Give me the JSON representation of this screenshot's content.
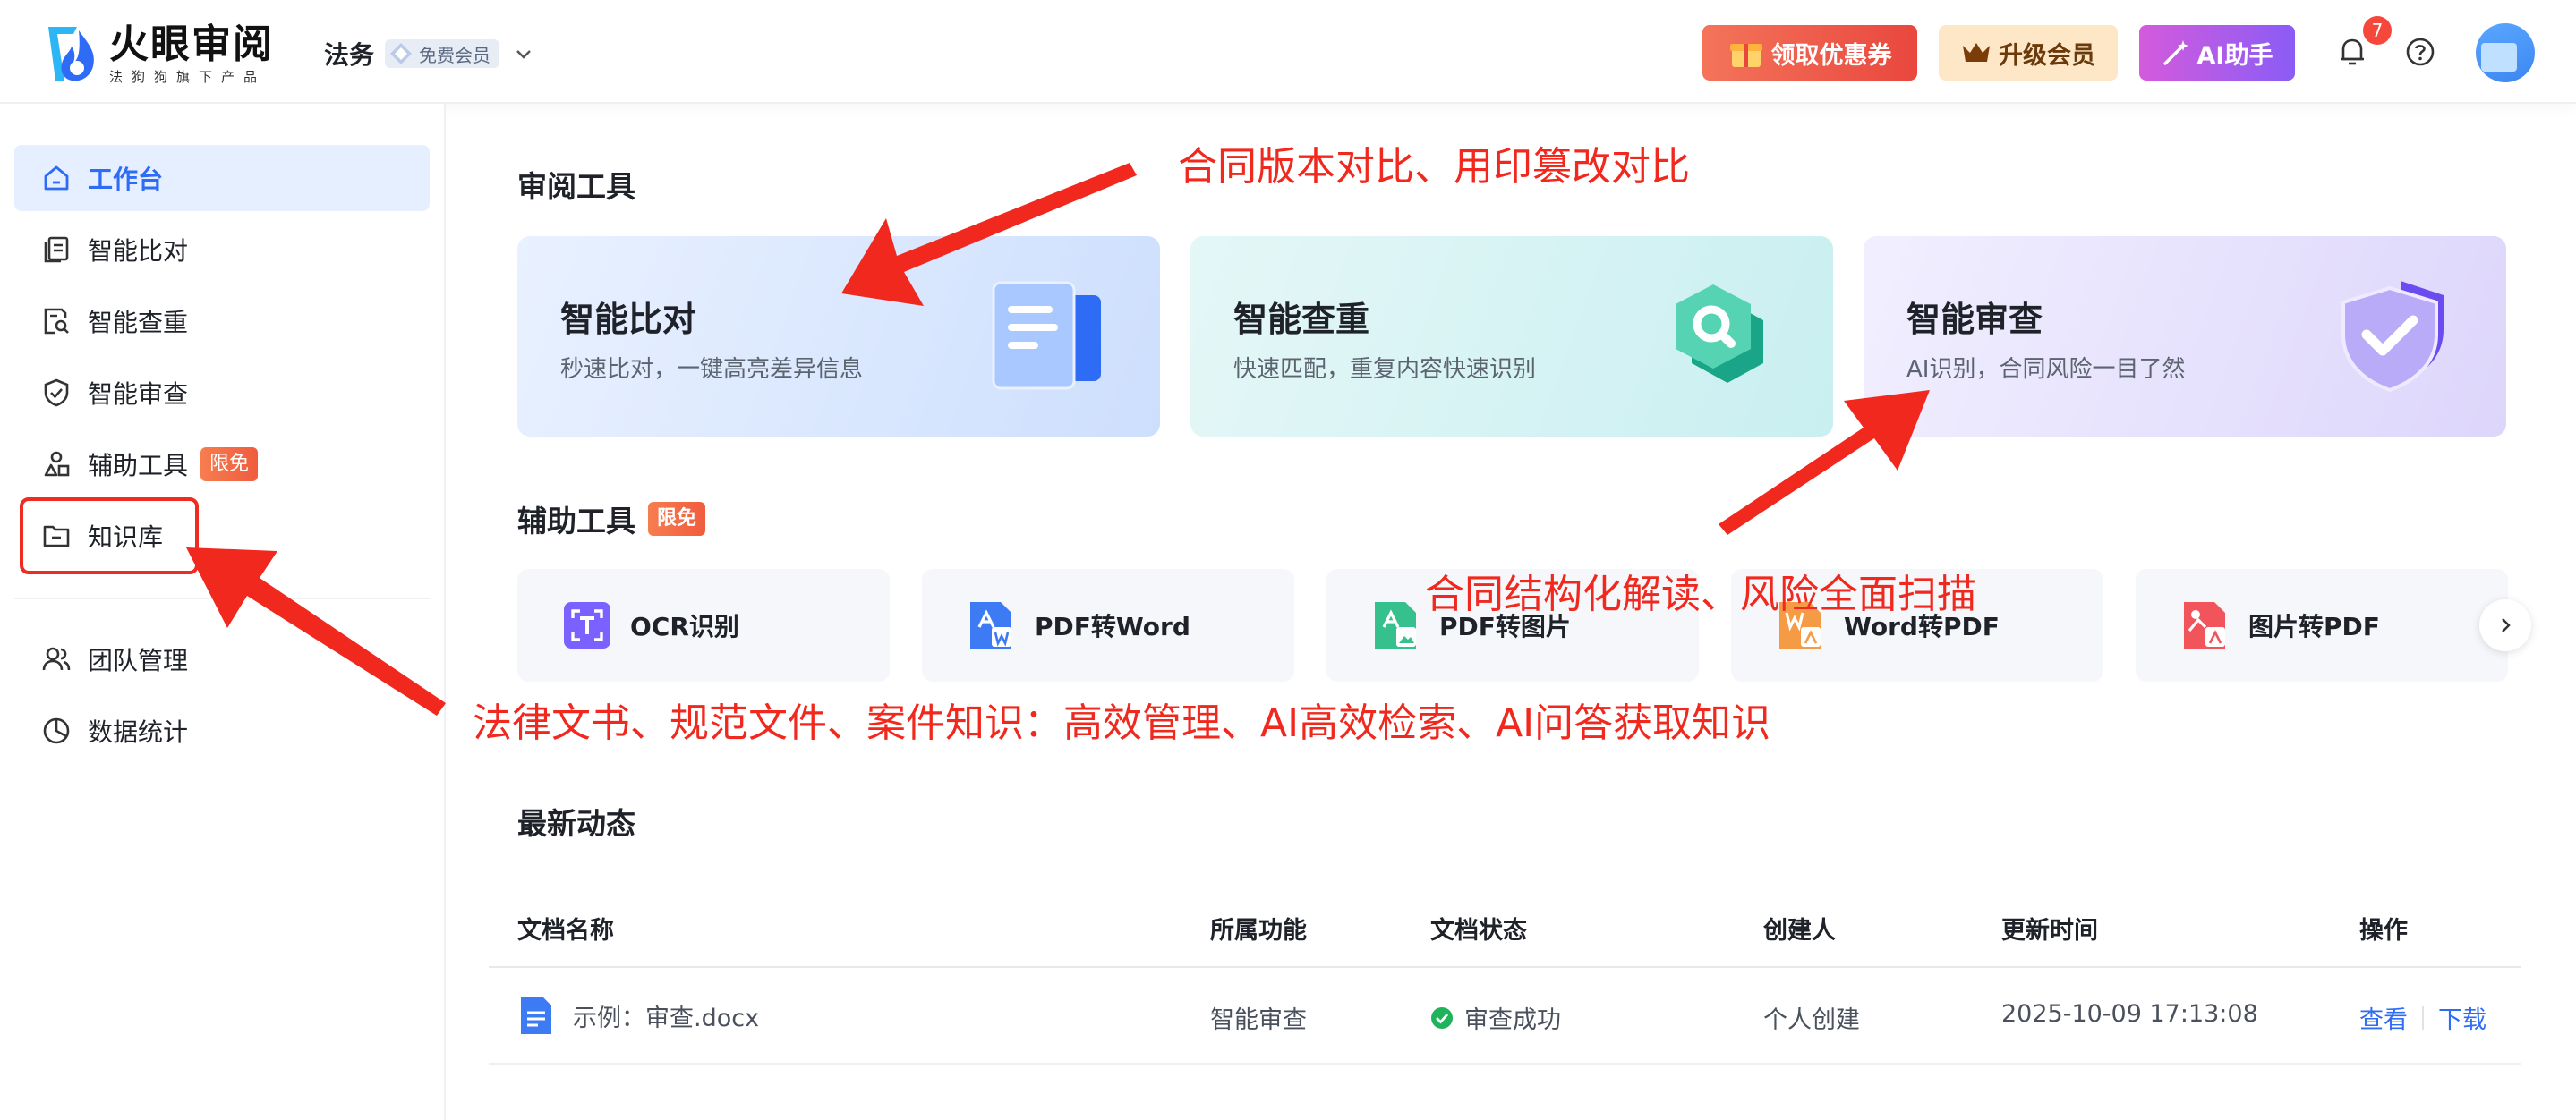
{
  "header": {
    "logo_title": "火眼审阅",
    "logo_sub": "法狗狗旗下产品",
    "org_name": "法务",
    "member_badge": "免费会员",
    "coupon_label": "领取优惠券",
    "upgrade_label": "升级会员",
    "ai_label": "AI助手",
    "notification_count": "7"
  },
  "sidebar": {
    "items": [
      {
        "label": "工作台",
        "icon": "home-icon"
      },
      {
        "label": "智能比对",
        "icon": "compare-icon"
      },
      {
        "label": "智能查重",
        "icon": "search-doc-icon"
      },
      {
        "label": "智能审查",
        "icon": "shield-check-icon"
      },
      {
        "label": "辅助工具",
        "icon": "shapes-icon",
        "tag": "限免"
      },
      {
        "label": "知识库",
        "icon": "folder-icon"
      },
      {
        "label": "团队管理",
        "icon": "team-icon"
      },
      {
        "label": "数据统计",
        "icon": "pie-chart-icon"
      }
    ]
  },
  "review_tools": {
    "title": "审阅工具",
    "cards": [
      {
        "title": "智能比对",
        "desc": "秒速比对，一键高亮差异信息"
      },
      {
        "title": "智能查重",
        "desc": "快速匹配，重复内容快速识别"
      },
      {
        "title": "智能审查",
        "desc": "AI识别，合同风险一目了然"
      }
    ]
  },
  "aux_tools": {
    "title": "辅助工具",
    "tag": "限免",
    "items": [
      {
        "label": "OCR识别",
        "color": "#7b61ff"
      },
      {
        "label": "PDF转Word",
        "color": "#3d7bf5"
      },
      {
        "label": "PDF转图片",
        "color": "#35c08e"
      },
      {
        "label": "Word转PDF",
        "color": "#f59a45"
      },
      {
        "label": "图片转PDF",
        "color": "#f2545b"
      }
    ]
  },
  "activity": {
    "title": "最新动态",
    "columns": [
      "文档名称",
      "所属功能",
      "文档状态",
      "创建人",
      "更新时间",
      "操作"
    ],
    "rows": [
      {
        "name": "示例：审查.docx",
        "feature": "智能审查",
        "status": "审查成功",
        "creator": "个人创建",
        "updated": "2025-10-09 17:13:08",
        "action_view": "查看",
        "action_download": "下载"
      }
    ]
  },
  "annotations": {
    "a1": "合同版本对比、用印篡改对比",
    "a2": "合同结构化解读、风险全面扫描",
    "a3": "法律文书、规范文件、案件知识：高效管理、AI高效检索、AI问答获取知识"
  },
  "colors": {
    "primary": "#2f6cf6",
    "annotation": "#f0281e",
    "success": "#1fb35c"
  }
}
